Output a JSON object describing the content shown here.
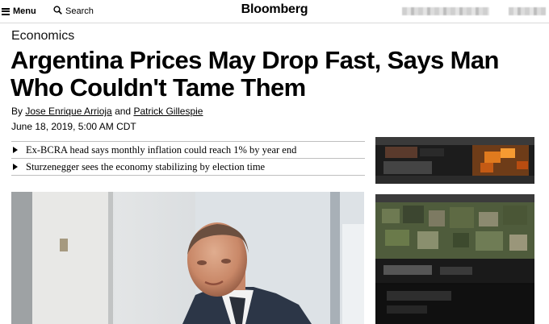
{
  "topbar": {
    "menu_label": "Menu",
    "search_label": "Search",
    "logo": "Bloomberg"
  },
  "article": {
    "section": "Economics",
    "headline": "Argentina Prices May Drop Fast, Says Man Who Couldn't Tame Them",
    "byline_prefix": "By ",
    "authors": [
      "Jose Enrique Arrioja",
      "Patrick Gillespie"
    ],
    "byline_and": " and ",
    "date": "June 18, 2019, 5:00 AM CDT",
    "summary": [
      "Ex-BCRA head says monthly inflation could reach 1% by year end",
      "Sturzenegger sees the economy stabilizing by election time"
    ]
  },
  "icons": {
    "menu": "hamburger-icon",
    "search": "magnifier-icon",
    "bullet": "triangle-right-icon"
  }
}
